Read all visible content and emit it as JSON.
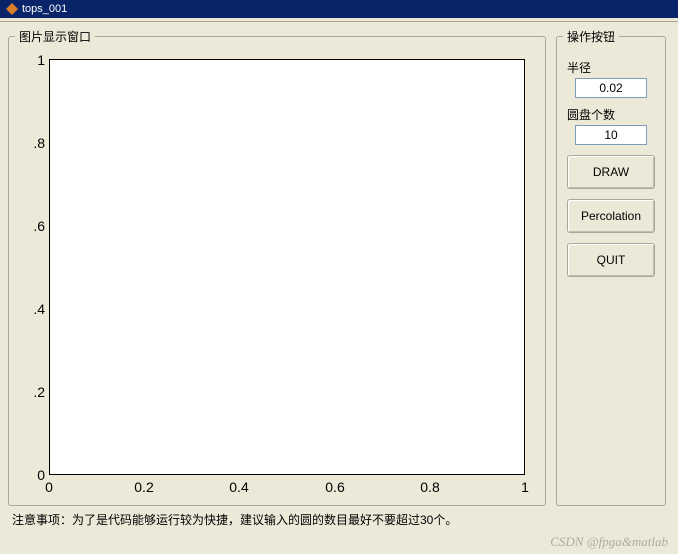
{
  "window": {
    "title": "tops_001"
  },
  "plot_panel": {
    "legend": "图片显示窗口"
  },
  "controls_panel": {
    "legend": "操作按钮",
    "radius_label": "半径",
    "radius_value": "0.02",
    "count_label": "圆盘个数",
    "count_value": "10",
    "draw_label": "DRAW",
    "percolation_label": "Percolation",
    "quit_label": "QUIT"
  },
  "note": "注意事项：为了是代码能够运行较为快捷，建议输入的圆的数目最好不要超过30个。",
  "watermark": "CSDN @fpga&matlab",
  "chart_data": {
    "type": "scatter",
    "x": [],
    "y": [],
    "title": "",
    "xlabel": "",
    "ylabel": "",
    "xlim": [
      0,
      1
    ],
    "ylim": [
      0,
      1
    ],
    "xticks": [
      0,
      0.2,
      0.4,
      0.6,
      0.8,
      1
    ],
    "yticks": [
      0,
      0.2,
      0.4,
      0.6,
      0.8,
      1
    ],
    "xtick_labels": [
      "0",
      "0.2",
      "0.4",
      "0.6",
      "0.8",
      "1"
    ],
    "ytick_labels": [
      "0",
      ".2",
      ".4",
      ".6",
      ".8",
      "1"
    ]
  }
}
